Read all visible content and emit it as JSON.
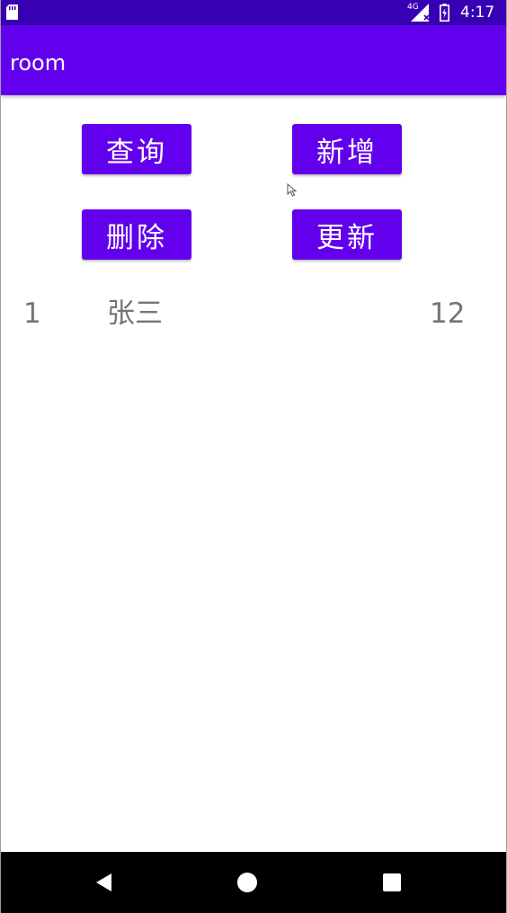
{
  "status_bar": {
    "network": "4G",
    "time": "4:17",
    "icons": [
      "sim-card-icon",
      "signal-icon",
      "battery-charging-icon"
    ]
  },
  "app_bar": {
    "title": "room"
  },
  "buttons": {
    "query": "查询",
    "add": "新增",
    "delete": "删除",
    "update": "更新"
  },
  "records": [
    {
      "id": "1",
      "name": "张三",
      "age": "12"
    }
  ],
  "nav_bar": {
    "icons": [
      "back-icon",
      "home-icon",
      "recent-apps-icon"
    ]
  },
  "colors": {
    "status_bar": "#3700b3",
    "primary": "#6200ee",
    "row_text": "#757575",
    "nav_bar": "#000000"
  }
}
